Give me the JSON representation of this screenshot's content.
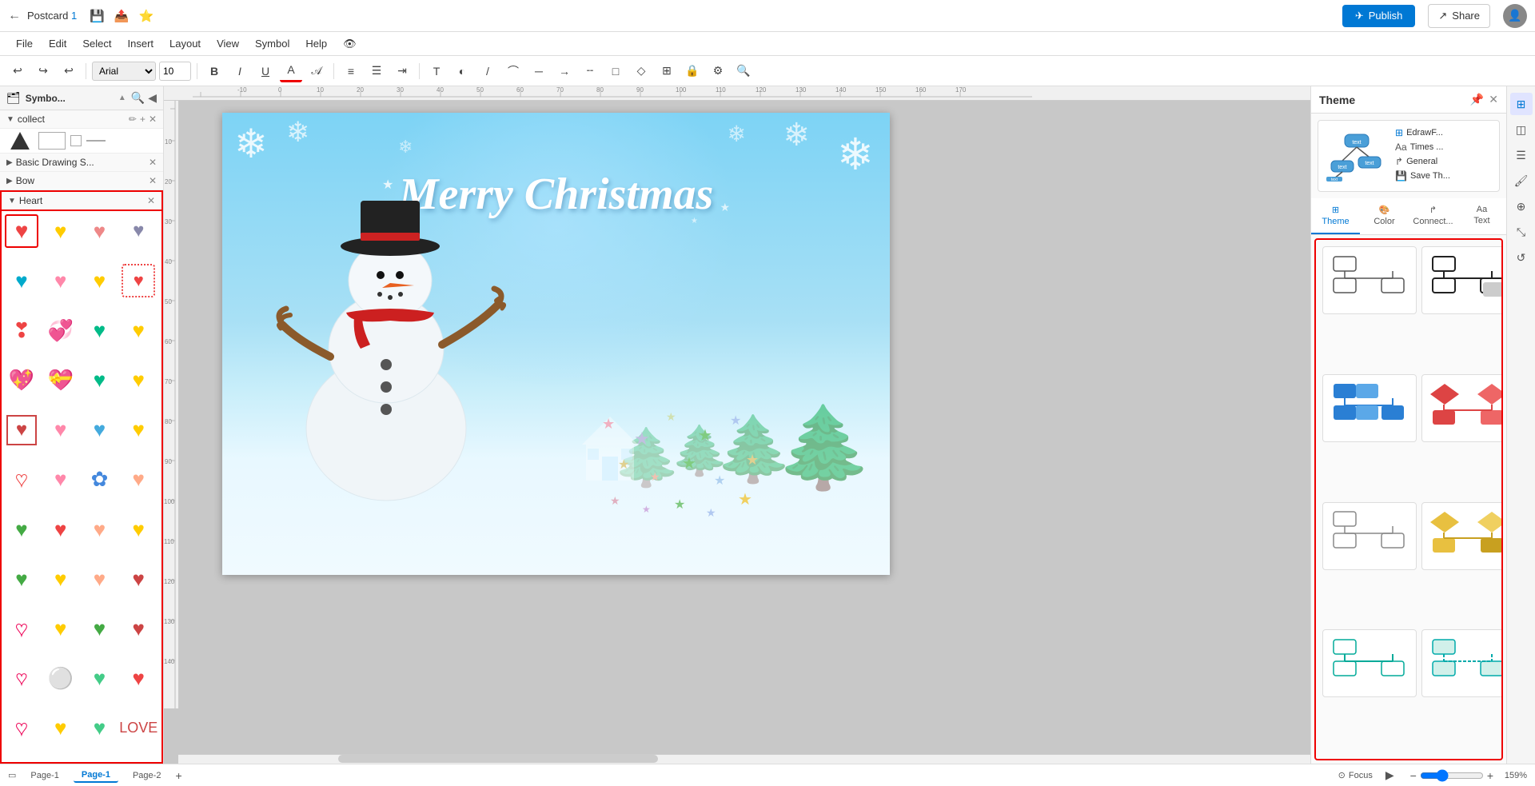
{
  "titlebar": {
    "title": "Postcard",
    "title_num": "1",
    "save_icon": "💾",
    "export_icon": "📤",
    "star_icon": "⭐",
    "publish_label": "Publish",
    "share_label": "Share"
  },
  "menubar": {
    "items": [
      "File",
      "Edit",
      "Select",
      "Insert",
      "Layout",
      "View",
      "Symbol",
      "Help",
      "👁"
    ]
  },
  "toolbar": {
    "undo": "↩",
    "redo": "↪",
    "undo2": "↩",
    "font": "Arial",
    "size": "10",
    "bold": "B",
    "italic": "I",
    "underline": "U",
    "color": "A",
    "align_left": "≡",
    "align_center": "☰"
  },
  "left_panel": {
    "title": "Symbo...",
    "search_icon": "🔍",
    "collapse_icon": "◀",
    "sections": [
      {
        "name": "collect",
        "label": "collect",
        "closeable": true,
        "collapsible": true
      },
      {
        "name": "basic-drawing",
        "label": "Basic Drawing S...",
        "closeable": true,
        "collapsible": true
      },
      {
        "name": "bow",
        "label": "Bow",
        "closeable": true,
        "collapsible": true
      },
      {
        "name": "heart",
        "label": "Heart",
        "closeable": true,
        "collapsible": true
      }
    ],
    "hearts": [
      {
        "color": "#e05",
        "symbol": "❤",
        "desc": "red heart"
      },
      {
        "color": "#f90",
        "symbol": "🧡",
        "desc": "orange heart"
      },
      {
        "color": "#e44",
        "symbol": "💗",
        "desc": "pink heart"
      },
      {
        "color": "#669",
        "symbol": "💙",
        "desc": "striped heart"
      },
      {
        "color": "#0ac",
        "symbol": "💚",
        "desc": "teal heart"
      },
      {
        "color": "#f8a",
        "symbol": "🩷",
        "desc": "light pink"
      },
      {
        "color": "#fc0",
        "symbol": "💛",
        "desc": "yellow heart"
      },
      {
        "color": "#e05",
        "symbol": "❤️",
        "desc": "spotted red"
      },
      {
        "color": "#e05",
        "symbol": "❣",
        "desc": "heart exclaim"
      },
      {
        "color": "#e44",
        "symbol": "💞",
        "desc": "revolving hearts"
      },
      {
        "color": "#0b8",
        "symbol": "💚",
        "desc": "green heart 2"
      },
      {
        "color": "#fc0",
        "symbol": "💛",
        "desc": "yellow 2"
      },
      {
        "color": "#e05",
        "symbol": "💖",
        "desc": "sparkling heart"
      },
      {
        "color": "#e44",
        "symbol": "💝",
        "desc": "heart ribbon"
      },
      {
        "color": "#0b8",
        "symbol": "💚",
        "desc": "green 3"
      },
      {
        "color": "#fc0",
        "symbol": "💛",
        "desc": "yellow 3"
      },
      {
        "color": "#c44",
        "symbol": "❤",
        "desc": "red 2"
      },
      {
        "color": "#e44",
        "symbol": "💗",
        "desc": "pink 2"
      },
      {
        "color": "#0ac",
        "symbol": "💚",
        "desc": "teal 2"
      },
      {
        "color": "#f80",
        "symbol": "🧡",
        "desc": "orange 2"
      },
      {
        "color": "#c44",
        "symbol": "❤",
        "desc": "outline red"
      },
      {
        "color": "#e44",
        "symbol": "💗",
        "desc": "outline pink"
      },
      {
        "color": "#48d",
        "symbol": "💙",
        "desc": "blue mandala"
      },
      {
        "color": "#fa8",
        "symbol": "🩷",
        "desc": "salmon"
      },
      {
        "color": "#4a4",
        "symbol": "💚",
        "desc": "green 4"
      },
      {
        "color": "#e44",
        "symbol": "🩷",
        "desc": "pink 3"
      },
      {
        "color": "#fa8",
        "symbol": "🩷",
        "desc": "salmon 2"
      },
      {
        "color": "#fc0",
        "symbol": "💛",
        "desc": "yellow 4"
      },
      {
        "color": "#4a4",
        "symbol": "💚",
        "desc": "green 5"
      },
      {
        "color": "#fc0",
        "symbol": "💛",
        "desc": "yellow 5"
      },
      {
        "color": "#fa8",
        "symbol": "🩷",
        "desc": "ornate"
      },
      {
        "color": "#c44",
        "symbol": "❤",
        "desc": "red 3"
      },
      {
        "color": "#e05",
        "symbol": "❤",
        "desc": "pink outline"
      },
      {
        "color": "#fc0",
        "symbol": "💛",
        "desc": "gold"
      },
      {
        "color": "#4a4",
        "symbol": "💚",
        "desc": "swirl green"
      },
      {
        "color": "#c44",
        "symbol": "❤",
        "desc": "red 4"
      },
      {
        "color": "#e05",
        "symbol": "❤",
        "desc": "outline 2"
      },
      {
        "color": "#f90",
        "symbol": "🧡",
        "desc": "orange ring"
      },
      {
        "color": "#4c8",
        "symbol": "💚",
        "desc": "teal 3"
      },
      {
        "color": "#e44",
        "symbol": "💗",
        "desc": "pink 4"
      },
      {
        "color": "#e05",
        "symbol": "❤",
        "desc": "bottom left"
      },
      {
        "color": "#fc0",
        "symbol": "💛",
        "desc": "yellow 6"
      },
      {
        "color": "#4c8",
        "symbol": "💚",
        "desc": "teal 4"
      },
      {
        "color": "#c44",
        "symbol": "❤",
        "desc": "love red"
      }
    ]
  },
  "canvas": {
    "card_text": "Merry Christmas"
  },
  "theme_panel": {
    "title": "Theme",
    "pin_icon": "📌",
    "close_icon": "✕",
    "preview": {
      "diagram_label": "EdrawF...",
      "font_label": "Times ...",
      "connector_label": "General",
      "save_label": "Save Th..."
    },
    "tabs": [
      {
        "id": "theme",
        "label": "Theme",
        "icon": "⊞"
      },
      {
        "id": "color",
        "label": "Color",
        "icon": "🎨"
      },
      {
        "id": "connect",
        "label": "Connect...",
        "icon": "↱"
      },
      {
        "id": "text",
        "label": "Text",
        "icon": "Aa"
      }
    ],
    "active_tab": "theme",
    "themes": [
      {
        "id": "default-white",
        "type": "white-outline"
      },
      {
        "id": "dark-outline",
        "type": "dark-outline"
      },
      {
        "id": "blue-fill",
        "type": "blue-fill"
      },
      {
        "id": "red-fill",
        "type": "red-fill"
      },
      {
        "id": "gray-outline",
        "type": "gray-outline"
      },
      {
        "id": "yellow-fill",
        "type": "yellow-fill"
      },
      {
        "id": "teal-outline",
        "type": "teal-outline"
      },
      {
        "id": "teal-fill",
        "type": "teal-fill"
      }
    ]
  },
  "right_icons": [
    {
      "id": "grid",
      "icon": "⊞",
      "active": true
    },
    {
      "id": "layers",
      "icon": "◫"
    },
    {
      "id": "properties",
      "icon": "☰"
    },
    {
      "id": "style",
      "icon": "🖌"
    },
    {
      "id": "position",
      "icon": "⊕"
    },
    {
      "id": "size",
      "icon": "⤡"
    },
    {
      "id": "history",
      "icon": "↺"
    }
  ],
  "bottombar": {
    "page_icon": "▭",
    "page1_label": "Page-1",
    "page2_label": "Page-2",
    "add_icon": "+",
    "focus_label": "Focus",
    "play_icon": "▶",
    "zoom_minus": "−",
    "zoom_value": "159%",
    "zoom_plus": "+"
  }
}
